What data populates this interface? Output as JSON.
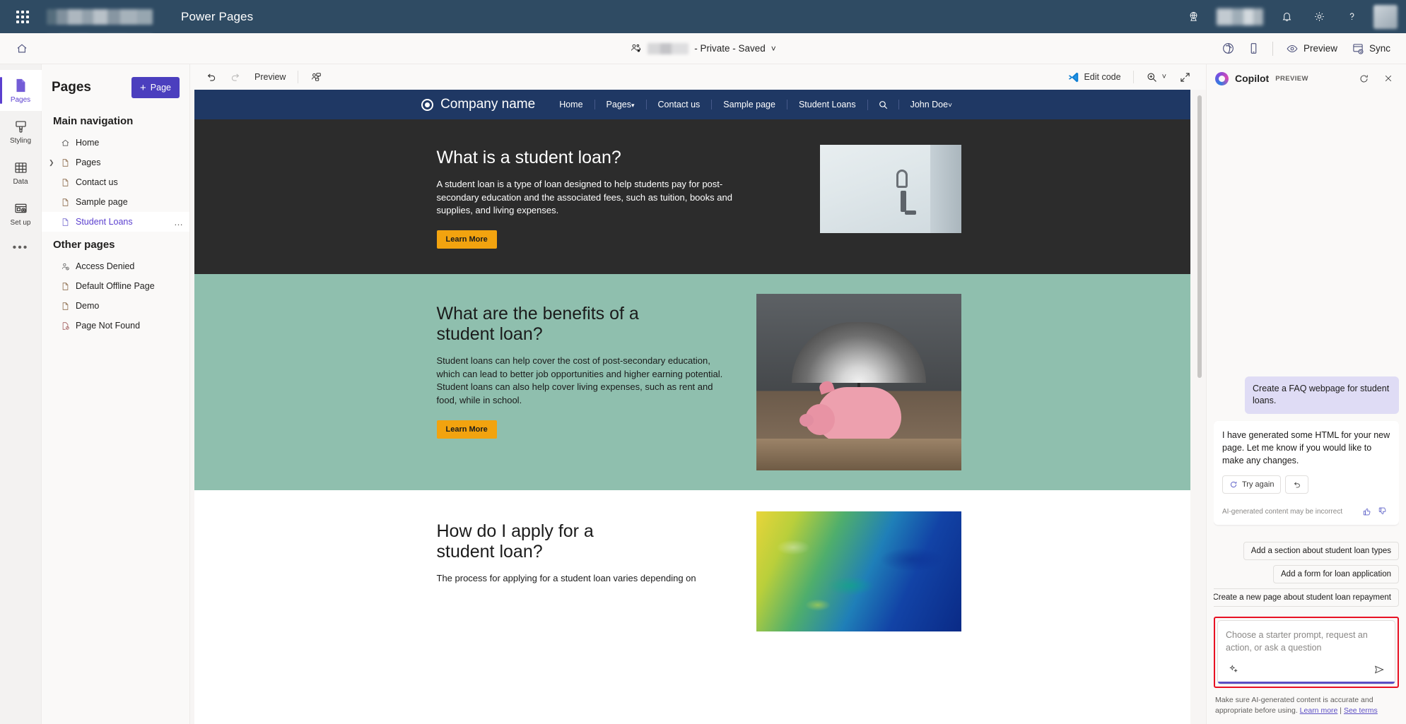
{
  "suite_bar": {
    "waffle_label": "app-launcher",
    "app_title": "Power Pages",
    "icons": [
      "environment-icon",
      "bell-icon",
      "gear-icon",
      "help-icon",
      "avatar"
    ]
  },
  "command_bar": {
    "home_icon": "home-icon",
    "site_status": "- Private - Saved",
    "chevron": "˅",
    "browser_icon": "browser-preview-icon",
    "mobile_icon": "mobile-preview-icon",
    "preview_label": "Preview",
    "sync_label": "Sync"
  },
  "rail": {
    "items": [
      {
        "label": "Pages",
        "icon": "page-icon",
        "active": true
      },
      {
        "label": "Styling",
        "icon": "brush-icon",
        "active": false
      },
      {
        "label": "Data",
        "icon": "table-icon",
        "active": false
      },
      {
        "label": "Set up",
        "icon": "setup-icon",
        "active": false
      }
    ],
    "more_label": "•••"
  },
  "pages_panel": {
    "title": "Pages",
    "add_button": "Page",
    "add_icon": "plus-icon",
    "sections": [
      {
        "title": "Main navigation",
        "items": [
          {
            "label": "Home",
            "icon": "home-page-icon",
            "expandable": false,
            "selected": false
          },
          {
            "label": "Pages",
            "icon": "file-icon",
            "expandable": true,
            "selected": false
          },
          {
            "label": "Contact us",
            "icon": "file-icon",
            "expandable": false,
            "selected": false
          },
          {
            "label": "Sample page",
            "icon": "file-icon",
            "expandable": false,
            "selected": false
          },
          {
            "label": "Student Loans",
            "icon": "file-icon",
            "expandable": false,
            "selected": true,
            "overflow": "…"
          }
        ]
      },
      {
        "title": "Other pages",
        "items": [
          {
            "label": "Access Denied",
            "icon": "person-denied-icon",
            "expandable": false,
            "selected": false
          },
          {
            "label": "Default Offline Page",
            "icon": "file-icon",
            "expandable": false,
            "selected": false
          },
          {
            "label": "Demo",
            "icon": "file-icon",
            "expandable": false,
            "selected": false
          },
          {
            "label": "Page Not Found",
            "icon": "file-not-found-icon",
            "expandable": false,
            "selected": false
          }
        ]
      }
    ]
  },
  "canvas_toolbar": {
    "undo_icon": "undo-icon",
    "redo_icon": "redo-icon",
    "preview_label": "Preview",
    "collaborate_icon": "collaborate-icon",
    "edit_code_label": "Edit code",
    "edit_code_icon": "vscode-icon",
    "zoom_icon": "zoom-icon",
    "zoom_chevron": "˅",
    "fullscreen_icon": "expand-icon"
  },
  "site_preview": {
    "brand": "Company name",
    "nav_links": [
      "Home",
      "Pages",
      "Contact us",
      "Sample page",
      "Student Loans"
    ],
    "pages_caret": "▾",
    "search_icon": "search-icon",
    "user_menu": "John Doe",
    "user_caret": "˅",
    "sections": [
      {
        "heading": "What is a student loan?",
        "body": "A student loan is a type of loan designed to help students pay for post-secondary education and the associated fees, such as tuition, books and supplies, and living expenses.",
        "cta": "Learn More",
        "image": "keys-on-wall-photo"
      },
      {
        "heading": "What are the benefits of a student loan?",
        "body": "Student loans can help cover the cost of post-secondary education, which can lead to better job opportunities and higher earning potential. Student loans can also help cover living expenses, such as rent and food, while in school.",
        "cta": "Learn More",
        "image": "piggy-bank-umbrella-photo"
      },
      {
        "heading": "How do I apply for a student loan?",
        "body": "The process for applying for a student loan varies depending on",
        "cta": "",
        "image": "abstract-map-photo"
      }
    ]
  },
  "copilot": {
    "title": "Copilot",
    "preview_badge": "PREVIEW",
    "refresh_icon": "refresh-icon",
    "close_icon": "close-icon",
    "messages": [
      {
        "role": "user",
        "text": "Create a FAQ webpage for student loans."
      },
      {
        "role": "assistant",
        "text": "I have generated some HTML for your new page. Let me know if you would like to make any changes."
      }
    ],
    "assistant_actions": {
      "try_again": "Try again",
      "try_again_icon": "refresh-icon",
      "undo_icon": "undo-icon"
    },
    "assistant_disclaimer": "AI-generated content may be incorrect",
    "thumbs_up_icon": "thumbs-up-icon",
    "thumbs_down_icon": "thumbs-down-icon",
    "suggestions": [
      "Add a section about student loan types",
      "Add a form for loan application",
      "Create a new page about student loan repayment"
    ],
    "compose_placeholder": "Choose a starter prompt, request an action, or ask a question",
    "compose_sparkle_icon": "sparkle-icon",
    "compose_send_icon": "send-icon",
    "footnote_text": "Make sure AI-generated content is accurate and appropriate before using.",
    "footnote_learn_more": "Learn more",
    "footnote_separator": "|",
    "footnote_see_terms": "See terms"
  },
  "colors": {
    "suite_bar": "#2f4b63",
    "accent_purple": "#4b3fbe",
    "site_nav": "#1f3864",
    "hero_dark": "#2c2c2c",
    "section_green": "#8fbfae",
    "cta_yellow": "#f2a30f",
    "highlight_red": "#e81123"
  }
}
